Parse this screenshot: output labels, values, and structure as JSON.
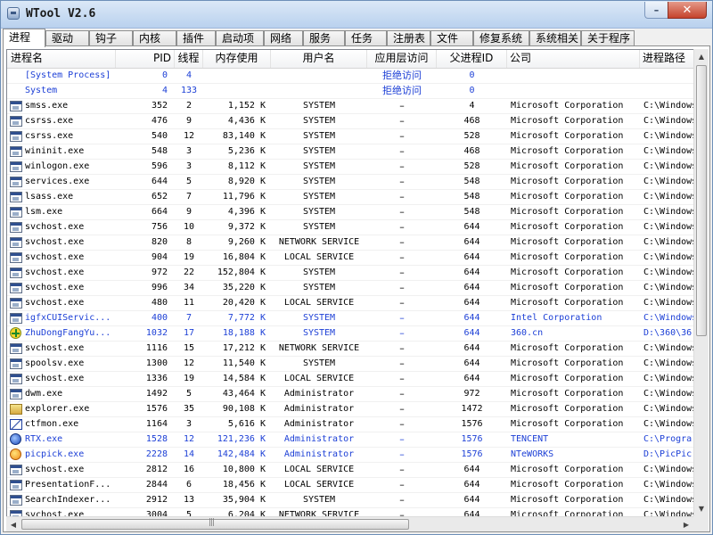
{
  "window": {
    "title": "WTool V2.6",
    "buttons": {
      "minimize": "–",
      "close": "✕"
    }
  },
  "tabs": [
    "进程",
    "驱动",
    "钩子",
    "内核",
    "插件",
    "启动项",
    "网络",
    "服务",
    "任务",
    "注册表",
    "文件",
    "修复系统",
    "系统相关",
    "关于程序"
  ],
  "active_tab": "进程",
  "columns": [
    "进程名",
    "PID",
    "线程",
    "内存使用",
    "用户名",
    "应用层访问",
    "父进程ID",
    "公司",
    "进程路径"
  ],
  "processes": [
    {
      "name": "[System Process]",
      "pid": "0",
      "threads": "4",
      "mem": "",
      "user": "",
      "access": "拒绝访问",
      "ppid": "0",
      "company": "",
      "path": "",
      "icon": "none",
      "highlight": true
    },
    {
      "name": "System",
      "pid": "4",
      "threads": "133",
      "mem": "",
      "user": "",
      "access": "拒绝访问",
      "ppid": "0",
      "company": "",
      "path": "",
      "icon": "none",
      "highlight": true
    },
    {
      "name": "smss.exe",
      "pid": "352",
      "threads": "2",
      "mem": "1,152 K",
      "user": "SYSTEM",
      "access": "–",
      "ppid": "4",
      "company": "Microsoft Corporation",
      "path": "C:\\Windows",
      "icon": "exe"
    },
    {
      "name": "csrss.exe",
      "pid": "476",
      "threads": "9",
      "mem": "4,436 K",
      "user": "SYSTEM",
      "access": "–",
      "ppid": "468",
      "company": "Microsoft Corporation",
      "path": "C:\\Windows",
      "icon": "exe"
    },
    {
      "name": "csrss.exe",
      "pid": "540",
      "threads": "12",
      "mem": "83,140 K",
      "user": "SYSTEM",
      "access": "–",
      "ppid": "528",
      "company": "Microsoft Corporation",
      "path": "C:\\Windows",
      "icon": "exe"
    },
    {
      "name": "wininit.exe",
      "pid": "548",
      "threads": "3",
      "mem": "5,236 K",
      "user": "SYSTEM",
      "access": "–",
      "ppid": "468",
      "company": "Microsoft Corporation",
      "path": "C:\\Windows",
      "icon": "exe"
    },
    {
      "name": "winlogon.exe",
      "pid": "596",
      "threads": "3",
      "mem": "8,112 K",
      "user": "SYSTEM",
      "access": "–",
      "ppid": "528",
      "company": "Microsoft Corporation",
      "path": "C:\\Windows",
      "icon": "exe"
    },
    {
      "name": "services.exe",
      "pid": "644",
      "threads": "5",
      "mem": "8,920 K",
      "user": "SYSTEM",
      "access": "–",
      "ppid": "548",
      "company": "Microsoft Corporation",
      "path": "C:\\Windows",
      "icon": "exe"
    },
    {
      "name": "lsass.exe",
      "pid": "652",
      "threads": "7",
      "mem": "11,796 K",
      "user": "SYSTEM",
      "access": "–",
      "ppid": "548",
      "company": "Microsoft Corporation",
      "path": "C:\\Windows",
      "icon": "exe"
    },
    {
      "name": "lsm.exe",
      "pid": "664",
      "threads": "9",
      "mem": "4,396 K",
      "user": "SYSTEM",
      "access": "–",
      "ppid": "548",
      "company": "Microsoft Corporation",
      "path": "C:\\Windows",
      "icon": "exe"
    },
    {
      "name": "svchost.exe",
      "pid": "756",
      "threads": "10",
      "mem": "9,372 K",
      "user": "SYSTEM",
      "access": "–",
      "ppid": "644",
      "company": "Microsoft Corporation",
      "path": "C:\\Windows",
      "icon": "exe"
    },
    {
      "name": "svchost.exe",
      "pid": "820",
      "threads": "8",
      "mem": "9,260 K",
      "user": "NETWORK SERVICE",
      "access": "–",
      "ppid": "644",
      "company": "Microsoft Corporation",
      "path": "C:\\Windows",
      "icon": "exe"
    },
    {
      "name": "svchost.exe",
      "pid": "904",
      "threads": "19",
      "mem": "16,804 K",
      "user": "LOCAL SERVICE",
      "access": "–",
      "ppid": "644",
      "company": "Microsoft Corporation",
      "path": "C:\\Windows",
      "icon": "exe"
    },
    {
      "name": "svchost.exe",
      "pid": "972",
      "threads": "22",
      "mem": "152,804 K",
      "user": "SYSTEM",
      "access": "–",
      "ppid": "644",
      "company": "Microsoft Corporation",
      "path": "C:\\Windows",
      "icon": "exe"
    },
    {
      "name": "svchost.exe",
      "pid": "996",
      "threads": "34",
      "mem": "35,220 K",
      "user": "SYSTEM",
      "access": "–",
      "ppid": "644",
      "company": "Microsoft Corporation",
      "path": "C:\\Windows",
      "icon": "exe"
    },
    {
      "name": "svchost.exe",
      "pid": "480",
      "threads": "11",
      "mem": "20,420 K",
      "user": "LOCAL SERVICE",
      "access": "–",
      "ppid": "644",
      "company": "Microsoft Corporation",
      "path": "C:\\Windows",
      "icon": "exe"
    },
    {
      "name": "igfxCUIServic...",
      "pid": "400",
      "threads": "7",
      "mem": "7,772 K",
      "user": "SYSTEM",
      "access": "–",
      "ppid": "644",
      "company": "Intel Corporation",
      "path": "C:\\Windows",
      "icon": "exe",
      "highlight": true
    },
    {
      "name": "ZhuDongFangYu...",
      "pid": "1032",
      "threads": "17",
      "mem": "18,188 K",
      "user": "SYSTEM",
      "access": "–",
      "ppid": "644",
      "company": "360.cn",
      "path": "D:\\360\\36",
      "icon": "zd",
      "highlight": true
    },
    {
      "name": "svchost.exe",
      "pid": "1116",
      "threads": "15",
      "mem": "17,212 K",
      "user": "NETWORK SERVICE",
      "access": "–",
      "ppid": "644",
      "company": "Microsoft Corporation",
      "path": "C:\\Windows",
      "icon": "exe"
    },
    {
      "name": "spoolsv.exe",
      "pid": "1300",
      "threads": "12",
      "mem": "11,540 K",
      "user": "SYSTEM",
      "access": "–",
      "ppid": "644",
      "company": "Microsoft Corporation",
      "path": "C:\\Windows",
      "icon": "exe"
    },
    {
      "name": "svchost.exe",
      "pid": "1336",
      "threads": "19",
      "mem": "14,584 K",
      "user": "LOCAL SERVICE",
      "access": "–",
      "ppid": "644",
      "company": "Microsoft Corporation",
      "path": "C:\\Windows",
      "icon": "exe"
    },
    {
      "name": "dwm.exe",
      "pid": "1492",
      "threads": "5",
      "mem": "43,464 K",
      "user": "Administrator",
      "access": "–",
      "ppid": "972",
      "company": "Microsoft Corporation",
      "path": "C:\\Windows",
      "icon": "exe"
    },
    {
      "name": "explorer.exe",
      "pid": "1576",
      "threads": "35",
      "mem": "90,108 K",
      "user": "Administrator",
      "access": "–",
      "ppid": "1472",
      "company": "Microsoft Corporation",
      "path": "C:\\Windows",
      "icon": "explorer"
    },
    {
      "name": "ctfmon.exe",
      "pid": "1164",
      "threads": "3",
      "mem": "5,616 K",
      "user": "Administrator",
      "access": "–",
      "ppid": "1576",
      "company": "Microsoft Corporation",
      "path": "C:\\Windows",
      "icon": "ctf"
    },
    {
      "name": "RTX.exe",
      "pid": "1528",
      "threads": "12",
      "mem": "121,236 K",
      "user": "Administrator",
      "access": "–",
      "ppid": "1576",
      "company": "TENCENT",
      "path": "C:\\Progra",
      "icon": "rtx",
      "highlight": true
    },
    {
      "name": "picpick.exe",
      "pid": "2228",
      "threads": "14",
      "mem": "142,484 K",
      "user": "Administrator",
      "access": "–",
      "ppid": "1576",
      "company": "NTeWORKS",
      "path": "D:\\PicPic",
      "icon": "pic",
      "highlight": true
    },
    {
      "name": "svchost.exe",
      "pid": "2812",
      "threads": "16",
      "mem": "10,800 K",
      "user": "LOCAL SERVICE",
      "access": "–",
      "ppid": "644",
      "company": "Microsoft Corporation",
      "path": "C:\\Windows",
      "icon": "exe"
    },
    {
      "name": "PresentationF...",
      "pid": "2844",
      "threads": "6",
      "mem": "18,456 K",
      "user": "LOCAL SERVICE",
      "access": "–",
      "ppid": "644",
      "company": "Microsoft Corporation",
      "path": "C:\\Windows",
      "icon": "exe"
    },
    {
      "name": "SearchIndexer...",
      "pid": "2912",
      "threads": "13",
      "mem": "35,904 K",
      "user": "SYSTEM",
      "access": "–",
      "ppid": "644",
      "company": "Microsoft Corporation",
      "path": "C:\\Windows",
      "icon": "exe"
    },
    {
      "name": "svchost.exe",
      "pid": "3004",
      "threads": "5",
      "mem": "6,204 K",
      "user": "NETWORK SERVICE",
      "access": "–",
      "ppid": "644",
      "company": "Microsoft Corporation",
      "path": "C:\\Windows",
      "icon": "exe"
    }
  ],
  "colors": {
    "highlight_text": "#1c3fd6",
    "close_button": "#c5432c"
  },
  "scrollbar": {
    "h_arrow_left": "◀",
    "h_arrow_right": "▶",
    "v_arrow_up": "▲",
    "v_arrow_down": "▼",
    "thumb_grip": "|||"
  }
}
